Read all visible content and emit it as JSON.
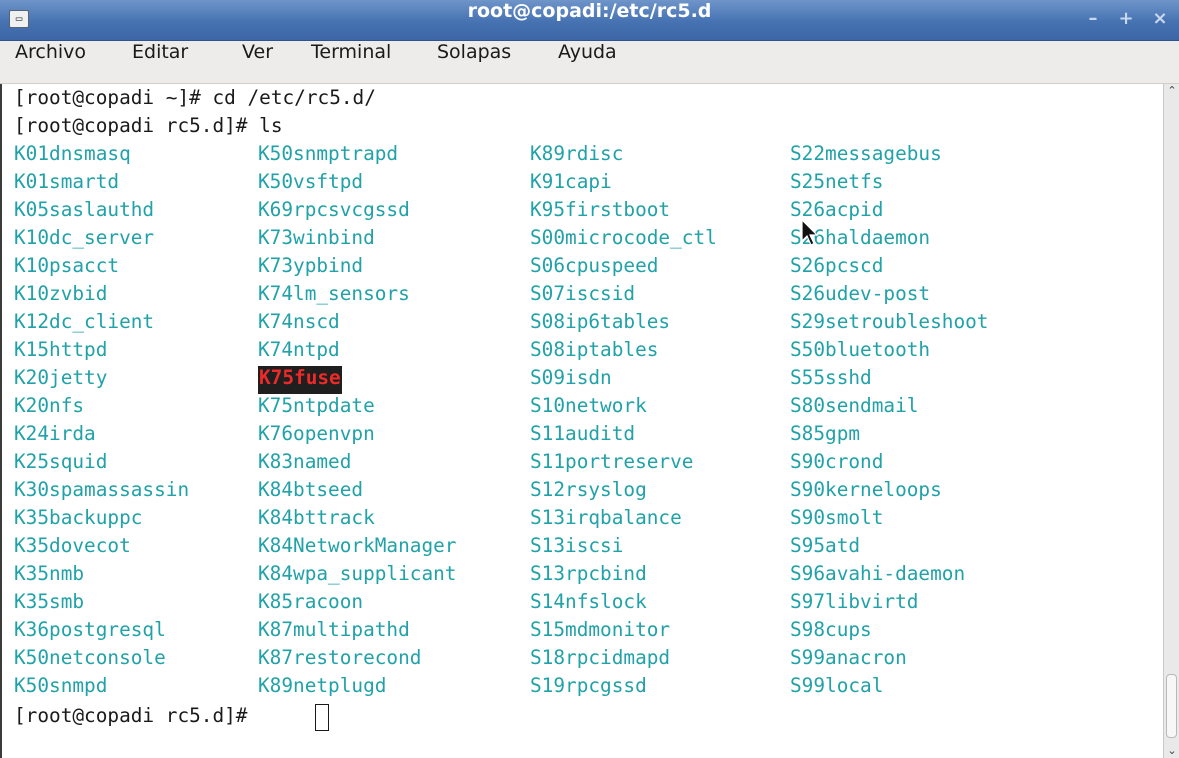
{
  "window": {
    "title": "root@copadi:/etc/rc5.d",
    "app_icon_glyph": "▭",
    "buttons": {
      "minimize": "–",
      "maximize": "+",
      "close": "×"
    }
  },
  "menubar": {
    "items": [
      "Archivo",
      "Editar",
      "Ver",
      "Terminal",
      "Solapas",
      "Ayuda"
    ]
  },
  "terminal": {
    "lines": [
      "[root@copadi ~]# cd /etc/rc5.d/",
      "[root@copadi rc5.d]# ls"
    ],
    "prompt": "[root@copadi rc5.d]#",
    "ls_color": "#21a2a8",
    "highlight_color": "#ec2a2a",
    "ls_columns": [
      [
        "K01dnsmasq",
        "K01smartd",
        "K05saslauthd",
        "K10dc_server",
        "K10psacct",
        "K10zvbid",
        "K12dc_client",
        "K15httpd",
        "K20jetty",
        "K20nfs",
        "K24irda",
        "K25squid",
        "K30spamassassin",
        "K35backuppc",
        "K35dovecot",
        "K35nmb",
        "K35smb",
        "K36postgresql",
        "K50netconsole",
        "K50snmpd"
      ],
      [
        "K50snmptrapd",
        "K50vsftpd",
        "K69rpcsvcgssd",
        "K73winbind",
        "K73ypbind",
        "K74lm_sensors",
        "K74nscd",
        "K74ntpd",
        "K75fuse",
        "K75ntpdate",
        "K76openvpn",
        "K83named",
        "K84btseed",
        "K84bttrack",
        "K84NetworkManager",
        "K84wpa_supplicant",
        "K85racoon",
        "K87multipathd",
        "K87restorecond",
        "K89netplugd"
      ],
      [
        "K89rdisc",
        "K91capi",
        "K95firstboot",
        "S00microcode_ctl",
        "S06cpuspeed",
        "S07iscsid",
        "S08ip6tables",
        "S08iptables",
        "S09isdn",
        "S10network",
        "S11auditd",
        "S11portreserve",
        "S12rsyslog",
        "S13irqbalance",
        "S13iscsi",
        "S13rpcbind",
        "S14nfslock",
        "S15mdmonitor",
        "S18rpcidmapd",
        "S19rpcgssd"
      ],
      [
        "S22messagebus",
        "S25netfs",
        "S26acpid",
        "S26haldaemon",
        "S26pcscd",
        "S26udev-post",
        "S29setroubleshoot",
        "S50bluetooth",
        "S55sshd",
        "S80sendmail",
        "S85gpm",
        "S90crond",
        "S90kerneloops",
        "S90smolt",
        "S95atd",
        "S96avahi-daemon",
        "S97libvirtd",
        "S98cups",
        "S99anacron",
        "S99local"
      ]
    ],
    "highlighted_item": "K75fuse"
  }
}
